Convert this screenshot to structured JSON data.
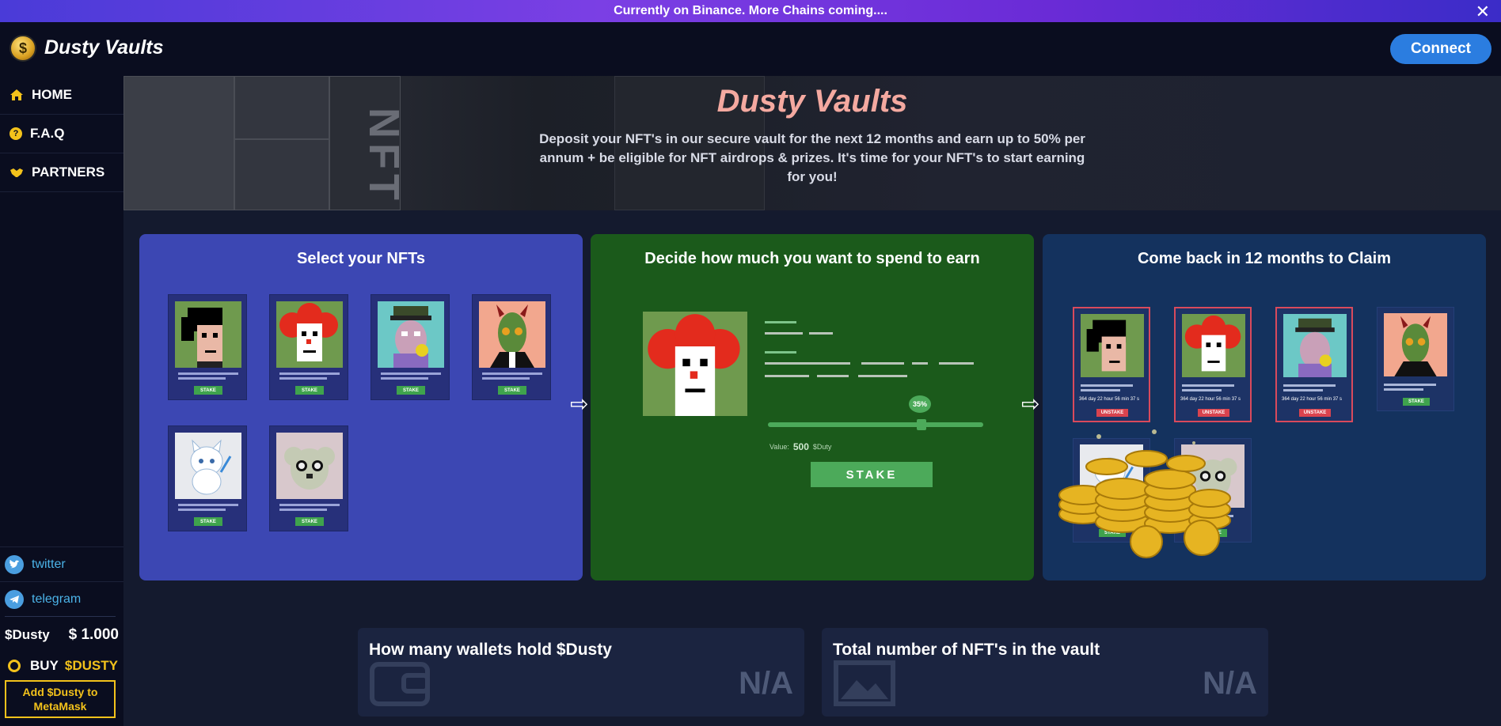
{
  "banner": {
    "text": "Currently on Binance. More Chains coming....",
    "close": "✕"
  },
  "header": {
    "title": "Dusty Vaults",
    "connect_label": "Connect"
  },
  "sidebar": {
    "items": [
      {
        "label": "HOME",
        "icon": "home-icon"
      },
      {
        "label": "F.A.Q",
        "icon": "question-icon"
      },
      {
        "label": "PARTNERS",
        "icon": "handshake-icon"
      }
    ],
    "social": [
      {
        "label": "twitter",
        "icon": "twitter-icon"
      },
      {
        "label": "telegram",
        "icon": "telegram-icon"
      }
    ],
    "price_ticker": "$Dusty",
    "price_value": "$ 1.000",
    "buy_label": "BUY",
    "buy_token": "$DUSTY",
    "add_metamask": "Add $Dusty to MetaMask"
  },
  "hero": {
    "title": "Dusty Vaults",
    "description": "Deposit your NFT's in our secure vault for the next 12 months and earn up to 50% per annum + be eligible for NFT airdrops & prizes. It's time for your NFT's to start earning for you!"
  },
  "steps": [
    {
      "title": "Select your NFTs",
      "stake_label": "STAKE"
    },
    {
      "title": "Decide how much you want to spend to earn",
      "percent": "35%",
      "value_label": "Value:",
      "value": "500",
      "value_unit": "$Duty",
      "stake_button": "STAKE"
    },
    {
      "title": "Come back in 12 months to Claim",
      "stat_line": "364 day 22 hour 56 min 37 s",
      "unstake_label": "UNSTAKE",
      "stake_label": "STAKE"
    }
  ],
  "stats": [
    {
      "label": "How many wallets hold $Dusty",
      "value": "N/A",
      "icon": "wallet-icon"
    },
    {
      "label": "Total number of NFT's in the vault",
      "value": "N/A",
      "icon": "image-icon"
    }
  ],
  "colors": {
    "accent": "#2b7de0",
    "gold": "#f3c21b",
    "hero_title": "#f4a9a0",
    "card1": "#3c47b3",
    "card2": "#1b5a1b",
    "card3": "#14325e"
  }
}
